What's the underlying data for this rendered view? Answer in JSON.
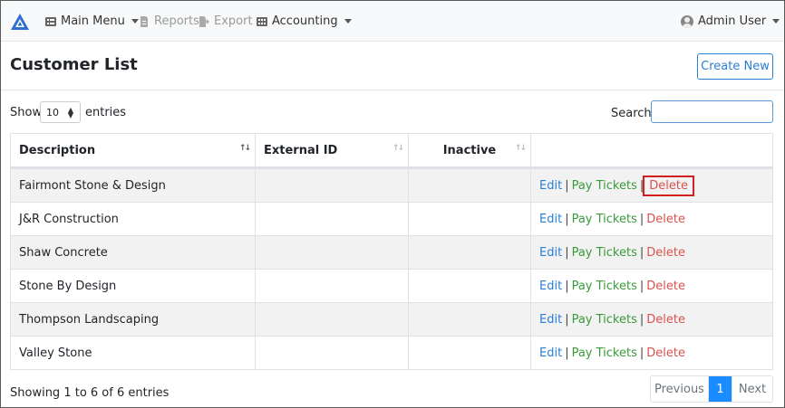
{
  "nav": {
    "main_menu": "Main Menu",
    "reports": "Reports",
    "export": "Export",
    "accounting": "Accounting",
    "user": "Admin User"
  },
  "page": {
    "title": "Customer List",
    "create_button": "Create New"
  },
  "controls": {
    "show_label": "Show",
    "show_value": "10",
    "entries_label": "entries",
    "search_label": "Search:",
    "search_value": ""
  },
  "table": {
    "headers": [
      "Description",
      "External ID",
      "Inactive",
      ""
    ],
    "rows": [
      {
        "description": "Fairmont Stone & Design",
        "external_id": "",
        "inactive": "",
        "edit": "Edit",
        "pay": "Pay Tickets",
        "delete": "Delete"
      },
      {
        "description": "J&R Construction",
        "external_id": "",
        "inactive": "",
        "edit": "Edit",
        "pay": "Pay Tickets",
        "delete": "Delete"
      },
      {
        "description": "Shaw Concrete",
        "external_id": "",
        "inactive": "",
        "edit": "Edit",
        "pay": "Pay Tickets",
        "delete": "Delete"
      },
      {
        "description": "Stone By Design",
        "external_id": "",
        "inactive": "",
        "edit": "Edit",
        "pay": "Pay Tickets",
        "delete": "Delete"
      },
      {
        "description": "Thompson Landscaping",
        "external_id": "",
        "inactive": "",
        "edit": "Edit",
        "pay": "Pay Tickets",
        "delete": "Delete"
      },
      {
        "description": "Valley Stone",
        "external_id": "",
        "inactive": "",
        "edit": "Edit",
        "pay": "Pay Tickets",
        "delete": "Delete"
      }
    ],
    "separator": "|"
  },
  "footer": {
    "info": "Showing 1 to 6 of 6 entries",
    "previous": "Previous",
    "page": "1",
    "next": "Next"
  },
  "colors": {
    "accent": "#2a7fd4",
    "pay": "#3a9a3a",
    "delete": "#d9534f",
    "highlight": "#d21f1f",
    "active_page": "#1a8cff"
  }
}
